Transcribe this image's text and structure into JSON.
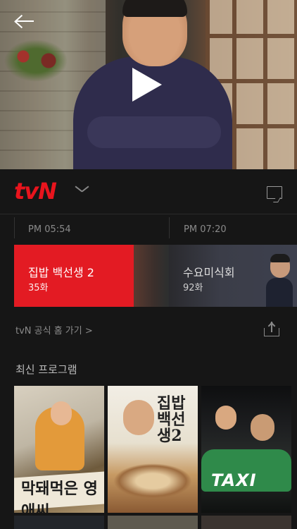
{
  "hero": {
    "back_label": "",
    "play_label": ""
  },
  "channel": {
    "logo_text": "tvN",
    "brand_color": "#e8141d"
  },
  "schedule": [
    {
      "time": "PM 05:54",
      "title": "집밥 백선생 2",
      "episode": "35화",
      "state": "on-air"
    },
    {
      "time": "PM 07:20",
      "title": "수요미식회",
      "episode": "92화",
      "state": "next"
    }
  ],
  "links": {
    "official_home": "tvN 공식 홈 가기 >"
  },
  "latest": {
    "title": "최신 프로그램",
    "posters": [
      {
        "text": "막돼먹은 영애씨"
      },
      {
        "text": "집밥 백선생2"
      },
      {
        "text": "TAXI"
      }
    ]
  }
}
